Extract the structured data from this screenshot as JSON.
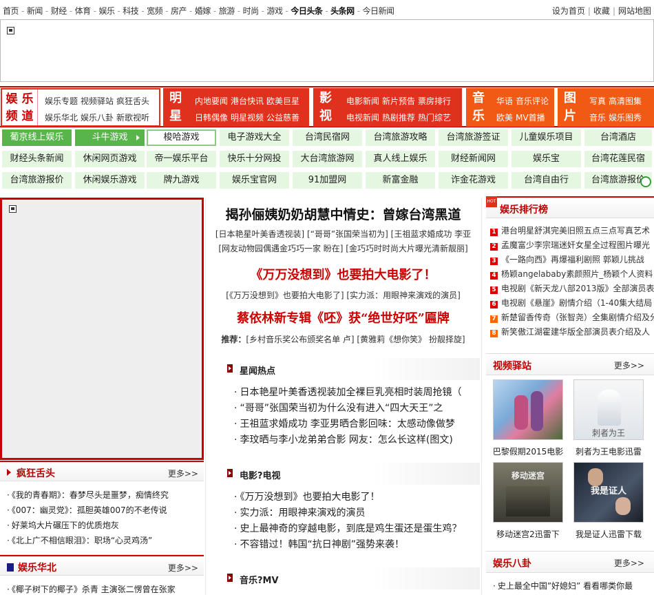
{
  "topnav": {
    "items": [
      "首页",
      "新闻",
      "财经",
      "体育",
      "娱乐",
      "科技",
      "宽频",
      "房产",
      "婚嫁",
      "旅游",
      "时尚",
      "游戏",
      "今日头条",
      "头条网",
      "今日新闻"
    ],
    "right": [
      "设为首页",
      "收藏",
      "网站地图"
    ]
  },
  "channels": {
    "ent_title_1": "娱 乐",
    "ent_title_2": "频 道",
    "ent_links_row1": [
      "娱乐专题",
      "视频驿站",
      "疯狂舌头"
    ],
    "ent_links_row2": [
      "娱乐华北",
      "娱乐八卦",
      "新歌视听"
    ],
    "star_title": [
      "明",
      "星"
    ],
    "star_row1": [
      "内地要闻",
      "港台快讯",
      "欧美巨星"
    ],
    "star_row2": [
      "日韩偶像",
      "明星视频",
      "公益慈善"
    ],
    "film_title": [
      "影",
      "视"
    ],
    "film_row1": [
      "电影新闻",
      "新片预告",
      "票房排行"
    ],
    "film_row2": [
      "电视新闻",
      "热剧推荐",
      "热门综艺"
    ],
    "music_title": [
      "音",
      "乐"
    ],
    "music_row1": [
      "华语",
      "音乐评论"
    ],
    "music_row2": [
      "欧美",
      "MV首播"
    ],
    "pic_title": [
      "图",
      "片"
    ],
    "pic_row1": [
      "写真",
      "高清图集"
    ],
    "pic_row2": [
      "音乐",
      "娱乐图秀"
    ]
  },
  "tags": {
    "row1": [
      "葡京线上娱乐",
      "斗牛游戏",
      "梭哈游戏",
      "电子游戏大全",
      "台湾民宿网",
      "台湾旅游攻略",
      "台湾旅游签证",
      "儿童娱乐项目",
      "台湾酒店"
    ],
    "row2": [
      "财经头条新闻",
      "休闲网页游戏",
      "帝一娱乐平台",
      "快乐十分网投",
      "大台湾旅游网",
      "真人线上娱乐",
      "财经新闻网",
      "娱乐宝",
      "台湾花莲民宿"
    ],
    "row3": [
      "台湾旅游报价",
      "休闲娱乐游戏",
      "牌九游戏",
      "娱乐宝官网",
      "91加盟网",
      "新富金融",
      "诈金花游戏",
      "台湾自由行",
      "台湾旅游报价"
    ]
  },
  "left": {
    "crazy_title": "疯狂舌头",
    "crazy_more": "更多>>",
    "crazy_items": [
      "《我的青春期》：春梦尽头是噩梦，痴情终究",
      "《007：幽灵党》：孤胆英雄007的不老传说",
      "好莱坞大片碾压下的优质炮灰",
      "《北上广不相信眼泪》：职场“心灵鸡汤”"
    ],
    "north_title": "娱乐华北",
    "north_more": "更多>>",
    "north_items": [
      "《椰子树下的椰子》杀青 主演张二愣曾在张家"
    ]
  },
  "middle": {
    "headline1": "揭孙俪姨奶奶胡慧中情史：曾嫁台湾黑道",
    "sub1a": "[日本艳星叶美香透视装] [“哥哥”张国荣当初为] [王祖蓝求婚成功 李亚",
    "sub1b": "[网友动物园偶遇金巧巧一家 盼在] [金巧巧时时尚大片曝光清新靓丽]",
    "headline2": "《万万没想到》也要拍大电影了！",
    "sub2": "[《万万没想到》也要拍大电影了] [实力派：用眼神来演戏的演员]",
    "headline3": "蔡依林新专辑《呸》获“绝世好呸”匾牌",
    "sub3_label": "推荐：",
    "sub3": "[乡村音乐奖公布颁奖名单 卢] [黄雅莉《想你笑》 扮靓择旋]",
    "sec1_title": "星闻热点",
    "sec1_items": [
      "日本艳星叶美香透视装加全裸巨乳亮相时装周抢镜（",
      "“哥哥”张国荣当初为什么没有进入“四大天王”之",
      "王祖蓝求婚成功 李亚男晒合影回味：太感动像做梦",
      "李玟晒与李小龙弟弟合影 网友：怎么长这样(图文)"
    ],
    "sec2_title": "电影?电视",
    "sec2_items": [
      "《万万没想到》也要拍大电影了！",
      "实力派：用眼神来演戏的演员",
      "史上最神奇的穿越电影，到底是鸡生蛋还是蛋生鸡？",
      "不容错过！韩国“抗日神剧”强势来袭！"
    ],
    "sec3_title": "音乐?MV"
  },
  "right": {
    "rank_title": "娱乐排行榜",
    "rank_items": [
      "港台明星舒淇完美旧照五点三点写真艺术",
      "孟魔富少李宗瑞迷奸女星全过程图片曝光",
      "《一路向西》再爆福利剧照 郭颖儿挑战",
      "杨颖angelababy素颜照片_杨颖个人资料",
      "电视剧《新天龙八部2013版》全部演员表",
      "电视剧《悬崖》剧情介绍（1-40集大结局",
      "新楚留香传奇（张智尧）全集剧情介绍及分",
      "新笑傲江湖霍建华版全部演员表介绍及人"
    ],
    "video_title": "视频驿站",
    "video_more": "更多>>",
    "video_items": [
      "巴黎假期2015电影",
      "刺者为王电影迅雷",
      "移动迷宫2迅雷下",
      "我是证人迅雷下载"
    ],
    "video_thumb_texts": [
      "",
      "刺者为王",
      "移动迷宫",
      "我是证人"
    ],
    "gossip_title": "娱乐八卦",
    "gossip_more": "更多>>",
    "gossip_items": [
      "史上最全中国”好媳妇” 看看哪类你最"
    ]
  },
  "colors": {
    "brand_red": "#cc0000",
    "block_red": "#e0301e",
    "block_orange": "#f05a14",
    "tag_green": "#58b54b",
    "tag_light": "#e5f6e1"
  }
}
